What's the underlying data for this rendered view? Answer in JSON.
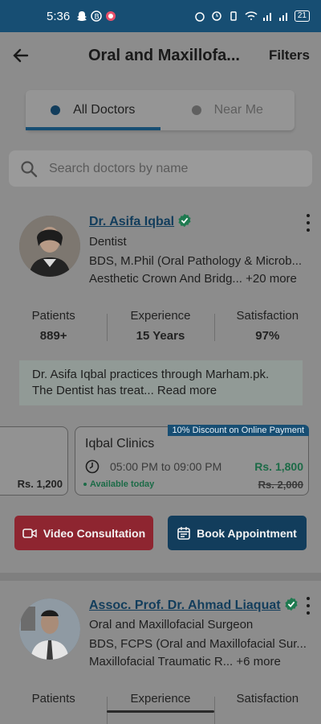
{
  "status_bar": {
    "time": "5:36",
    "battery": "21"
  },
  "header": {
    "title": "Oral and Maxillofa...",
    "filters_label": "Filters"
  },
  "segmented": {
    "options": [
      {
        "label": "All Doctors",
        "active": true
      },
      {
        "label": "Near Me",
        "active": false
      }
    ]
  },
  "search": {
    "placeholder": "Search doctors by name"
  },
  "doctors": [
    {
      "name": "Dr. Asifa Iqbal",
      "specialty": "Dentist",
      "qualifications": "BDS, M.Phil (Oral Pathology & Microb...",
      "services": "Aesthetic Crown And Bridg... +20 more",
      "stats": [
        {
          "label": "Patients",
          "value": "889+"
        },
        {
          "label": "Experience",
          "value": "15 Years"
        },
        {
          "label": "Satisfaction",
          "value": "97%"
        }
      ],
      "about": "Dr. Asifa Iqbal practices through Marham.pk. The Dentist  has treat...",
      "about_more": "Read more",
      "prev_clinic_price": "Rs. 1,200",
      "clinic": {
        "discount_badge": "10% Discount on Online Payment",
        "name": "Iqbal Clinics",
        "time": "05:00 PM to 09:00 PM",
        "fee": "Rs. 1,800",
        "old_fee": "Rs. 2,000",
        "availability": "Available today"
      },
      "buttons": {
        "video": "Video Consultation",
        "book": "Book Appointment"
      }
    },
    {
      "name": "Assoc. Prof. Dr. Ahmad Liaquat",
      "specialty": "Oral and Maxillofacial Surgeon",
      "qualifications": "BDS, FCPS (Oral and Maxillofacial Sur...",
      "services": "Maxillofacial Traumatic R... +6 more",
      "stats": [
        {
          "label": "Patients",
          "value": ""
        },
        {
          "label": "Experience",
          "value": ""
        },
        {
          "label": "Satisfaction",
          "value": ""
        }
      ]
    }
  ],
  "colors": {
    "primary": "#174e73",
    "danger": "#8e2530",
    "success": "#1c6b47"
  }
}
